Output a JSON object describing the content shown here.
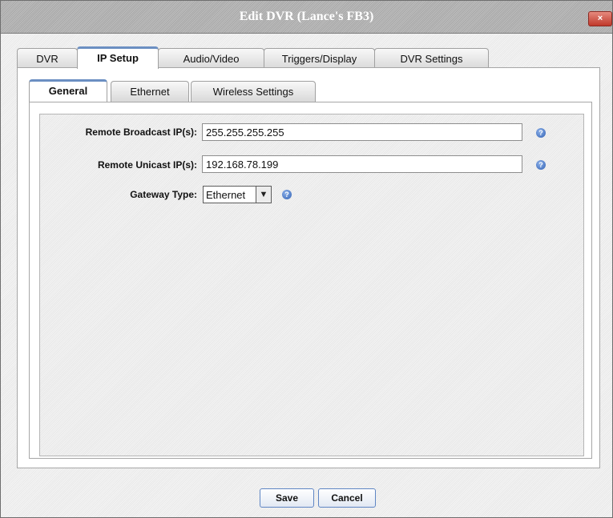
{
  "window": {
    "title": "Edit DVR (Lance's FB3)",
    "close_glyph": "×"
  },
  "tabs": [
    {
      "label": "DVR"
    },
    {
      "label": "IP Setup",
      "active": true
    },
    {
      "label": "Audio/Video"
    },
    {
      "label": "Triggers/Display"
    },
    {
      "label": "DVR Settings"
    }
  ],
  "subtabs": [
    {
      "label": "General",
      "active": true
    },
    {
      "label": "Ethernet"
    },
    {
      "label": "Wireless Settings"
    }
  ],
  "form": {
    "broadcast": {
      "label": "Remote Broadcast IP(s):",
      "value": "255.255.255.255"
    },
    "unicast": {
      "label": "Remote Unicast IP(s):",
      "value": "192.168.78.199"
    },
    "gateway": {
      "label": "Gateway Type:",
      "value": "Ethernet"
    },
    "help_glyph": "?"
  },
  "buttons": {
    "save": "Save",
    "cancel": "Cancel"
  },
  "colors": {
    "accent": "#6b8fc2",
    "close": "#c0392b",
    "help": "#2f5fb3"
  }
}
